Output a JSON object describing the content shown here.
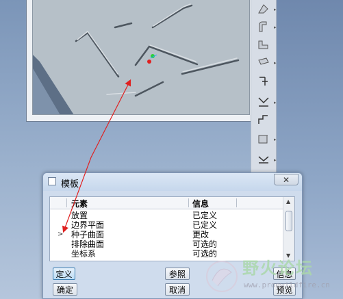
{
  "dialog": {
    "title": "模板",
    "close_symbol": "✕",
    "columns": [
      "元素",
      "信息"
    ],
    "rows": [
      {
        "element": "放置",
        "info": "已定义"
      },
      {
        "element": "边界平面",
        "info": "已定义"
      },
      {
        "element": "种子曲面",
        "info": "更改",
        "current": true
      },
      {
        "element": "排除曲面",
        "info": "可选的"
      },
      {
        "element": "坐标系",
        "info": "可选的"
      }
    ],
    "pointer_symbol": ">",
    "buttons": {
      "define": "定义",
      "reference": "参照",
      "info": "信息",
      "ok": "确定",
      "cancel": "取消",
      "preview": "预览"
    }
  },
  "watermark": {
    "text": "野火论坛",
    "url": "www.proewildfire.cn"
  },
  "colors": {
    "annotation_arrow": "#e02020",
    "dialog_bg": "#cfdced",
    "model_bg": "#b6c0c8"
  }
}
